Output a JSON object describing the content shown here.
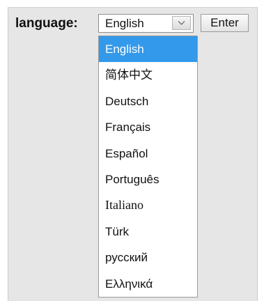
{
  "language_selector": {
    "label": "language:",
    "selected_value": "English",
    "enter_label": "Enter",
    "options": [
      "English",
      "简体中文",
      "Deutsch",
      "Français",
      "Español",
      "Português",
      "Italiano",
      "Türk",
      "русский",
      "Ελληνικά"
    ],
    "highlighted_option": "English",
    "highlight_color": "#3399ea"
  }
}
